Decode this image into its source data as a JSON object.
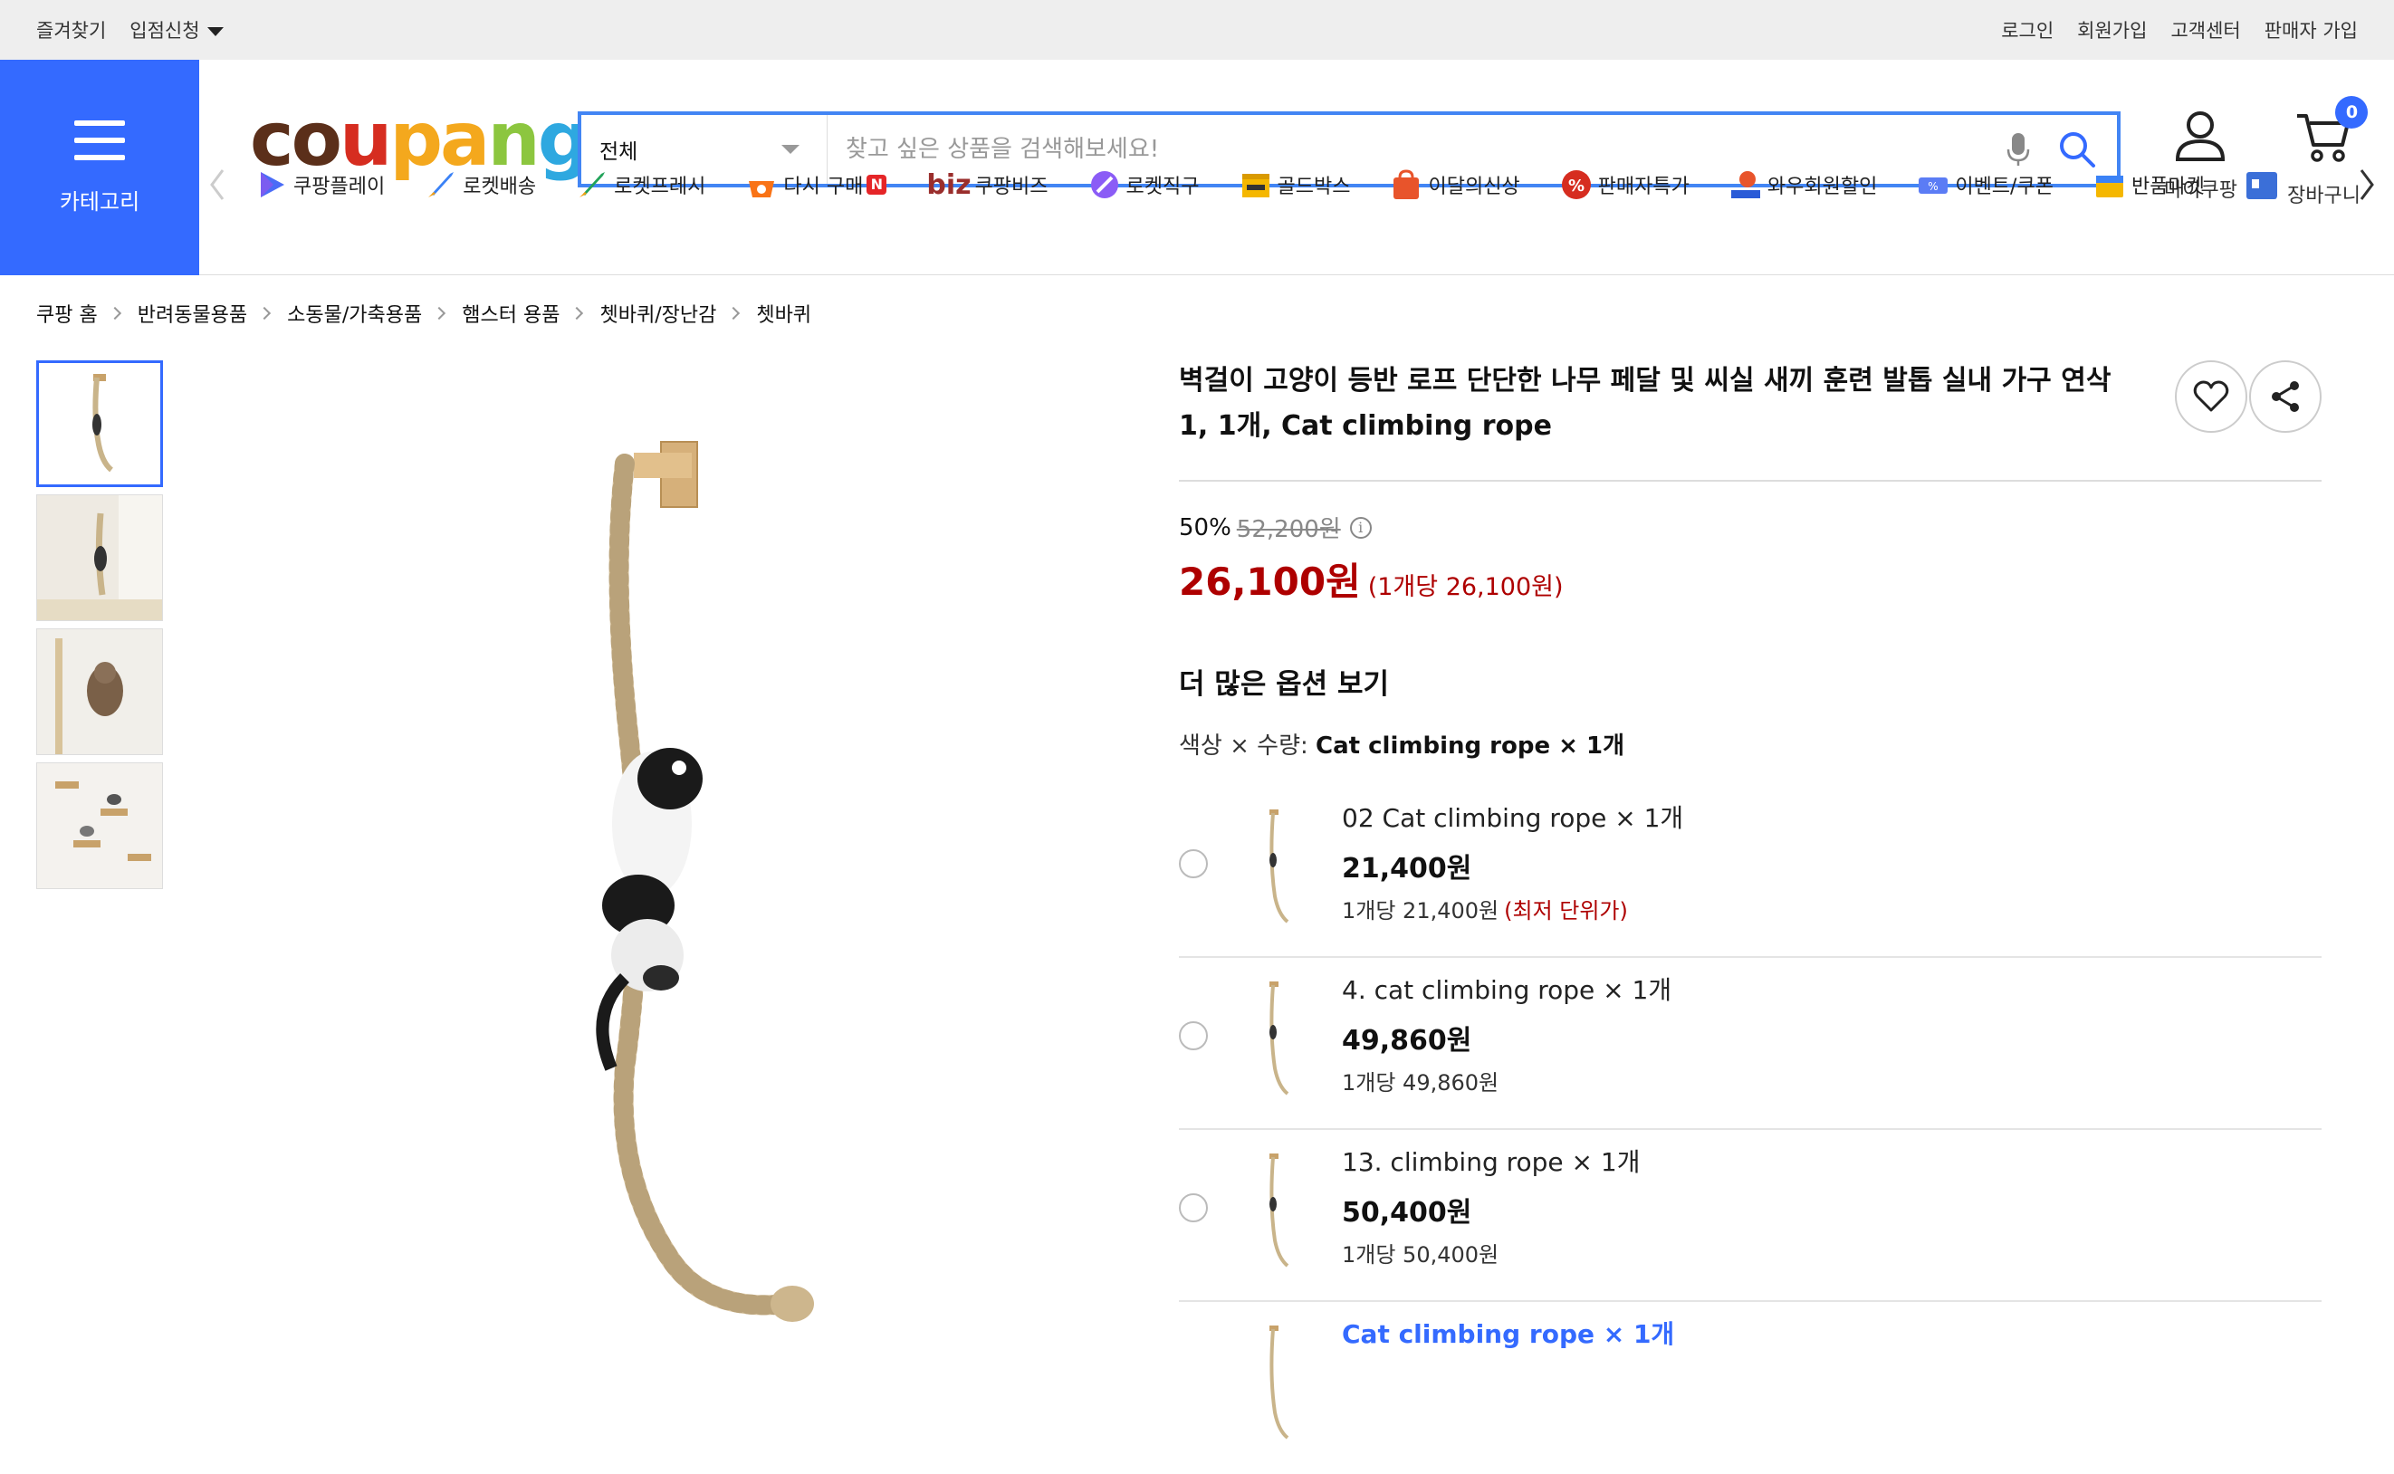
{
  "topbar": {
    "bookmark": "즐겨찾기",
    "apply": "입점신청",
    "login": "로그인",
    "signup": "회원가입",
    "support": "고객센터",
    "seller_signup": "판매자 가입"
  },
  "header": {
    "category_label": "카테고리",
    "logo": {
      "p1": "co",
      "p2": "u",
      "p3": "pa",
      "p4": "n",
      "p5": "g"
    },
    "search_scope": "전체",
    "search_placeholder": "찾고 싶은 상품을 검색해보세요!",
    "mycoupang": "마이쿠팡",
    "cart": "장바구니",
    "cart_count": "0"
  },
  "nav": {
    "items": [
      {
        "label": "쿠팡플레이",
        "icon": "play-icon"
      },
      {
        "label": "로켓배송",
        "icon": "rocket-icon"
      },
      {
        "label": "로켓프레시",
        "icon": "rocket-fresh-icon"
      },
      {
        "label": "다시 구매",
        "icon": "basket-icon",
        "badge": "N"
      },
      {
        "label": "쿠팡비즈",
        "icon": "biz-icon",
        "prefix": "biz"
      },
      {
        "label": "로켓직구",
        "icon": "rocket-global-icon"
      },
      {
        "label": "골드박스",
        "icon": "goldbox-icon"
      },
      {
        "label": "이달의신상",
        "icon": "new-bag-icon"
      },
      {
        "label": "판매자특가",
        "icon": "percent-icon"
      },
      {
        "label": "와우회원할인",
        "icon": "wow-icon"
      },
      {
        "label": "이벤트/쿠폰",
        "icon": "coupon-icon"
      },
      {
        "label": "반품마켓",
        "icon": "return-market-icon"
      }
    ]
  },
  "breadcrumb": [
    "쿠팡 홈",
    "반려동물용품",
    "소동물/가축용품",
    "햄스터 용품",
    "쳇바퀴/장난감",
    "쳇바퀴"
  ],
  "product": {
    "title": "벽걸이 고양이 등반 로프 단단한 나무 페달 및 씨실 새끼 훈련 발톱 실내 가구 연삭 1, 1개, Cat climbing rope",
    "discount": "50%",
    "original_price": "52,200원",
    "price": "26,100원",
    "unit_price": "(1개당 26,100원)",
    "more_options": "더 많은 옵션 보기",
    "selection_label": "색상 × 수량:",
    "selection_value": "Cat climbing rope × 1개"
  },
  "options": [
    {
      "name": "02 Cat climbing rope × 1개",
      "price": "21,400원",
      "unit": "1개당 21,400원",
      "tag": "(최저 단위가)"
    },
    {
      "name": "4. cat climbing rope × 1개",
      "price": "49,860원",
      "unit": "1개당 49,860원"
    },
    {
      "name": "13. climbing rope × 1개",
      "price": "50,400원",
      "unit": "1개당 50,400원"
    },
    {
      "name": "Cat climbing rope × 1개"
    }
  ],
  "colors": {
    "accent": "#346aff",
    "price_red": "#ae0000",
    "topbar_bg": "#eeeeee"
  }
}
